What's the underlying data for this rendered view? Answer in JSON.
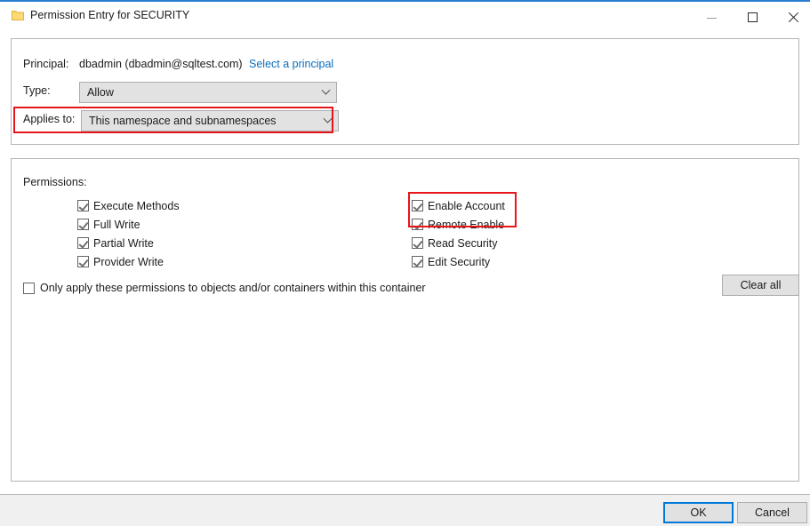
{
  "window": {
    "title": "Permission Entry for SECURITY",
    "icon": "folder-icon",
    "accent_color": "#2b7cd3",
    "controls": {
      "minimize": "–",
      "maximize": "□",
      "close": "✕"
    }
  },
  "general": {
    "principal_label": "Principal:",
    "principal_value": "dbadmin (dbadmin@sqltest.com)",
    "principal_link": "Select a principal",
    "principal_link_color": "#0a6ebd",
    "type_label": "Type:",
    "type_value": "Allow",
    "applies_to_label": "Applies to:",
    "applies_to_value": "This namespace and subnamespaces"
  },
  "permissions": {
    "label": "Permissions:",
    "left_column": [
      {
        "label": "Execute Methods",
        "checked": true
      },
      {
        "label": "Full Write",
        "checked": true
      },
      {
        "label": "Partial Write",
        "checked": true
      },
      {
        "label": "Provider Write",
        "checked": true
      }
    ],
    "right_column": [
      {
        "label": "Enable Account",
        "checked": true
      },
      {
        "label": "Remote Enable",
        "checked": true
      },
      {
        "label": "Read Security",
        "checked": true
      },
      {
        "label": "Edit Security",
        "checked": true
      }
    ],
    "only_apply_label": "Only apply these permissions to objects and/or containers within this container",
    "only_apply_checked": false,
    "clear_all_label": "Clear all"
  },
  "footer": {
    "ok_label": "OK",
    "cancel_label": "Cancel"
  },
  "annotations": {
    "color": "#e8151a",
    "boxes": [
      "applies-to-row",
      "enable-account-and-remote-enable"
    ]
  }
}
